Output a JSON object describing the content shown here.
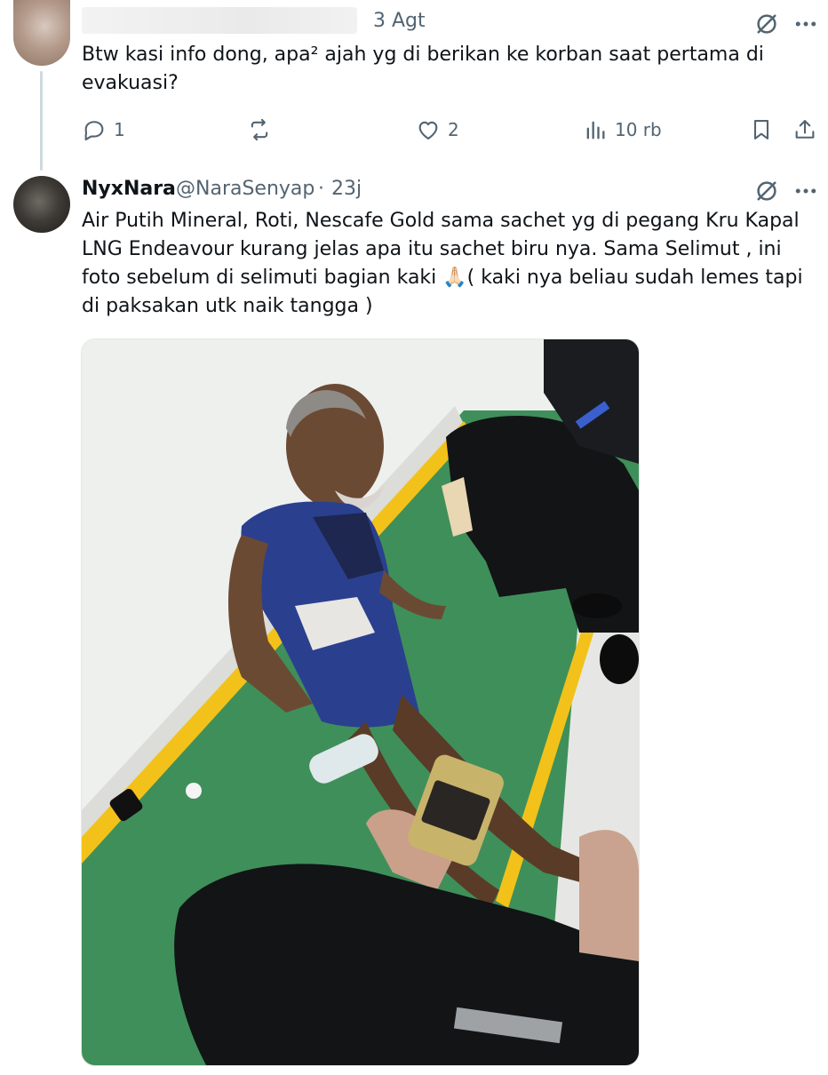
{
  "reply": {
    "time": "3 Agt",
    "text": "Btw kasi info dong, apa² ajah yg di berikan ke korban saat pertama di evakuasi?",
    "actions": {
      "replies": "1",
      "reposts": "",
      "likes": "2",
      "views": "10 rb"
    }
  },
  "tweet": {
    "display_name": "NyxNara",
    "handle": "@NaraSenyap",
    "separator": "·",
    "time": "23j",
    "text": "Air Putih Mineral, Roti, Nescafe Gold sama sachet yg di pegang Kru Kapal LNG Endeavour kurang jelas apa itu sachet biru nya. Sama Selimut , ini foto sebelum di selimuti bagian kaki 🙏🏻( kaki nya beliau sudah lemes tapi di paksakan utk naik tangga )"
  },
  "colors": {
    "text_primary": "#0f1419",
    "text_secondary": "#536471",
    "thread_line": "#cfd9de",
    "wall": "#eef0ee",
    "floor_green": "#3f8f5a",
    "floor_stripe": "#f2c21a",
    "shirt_blue": "#2b3f8f"
  },
  "icons": {
    "reply": "reply-icon",
    "repost": "repost-icon",
    "like": "heart-icon",
    "views": "views-chart-icon",
    "bookmark": "bookmark-icon",
    "share": "share-icon",
    "grok": "grok-icon",
    "more": "more-dots-icon"
  }
}
